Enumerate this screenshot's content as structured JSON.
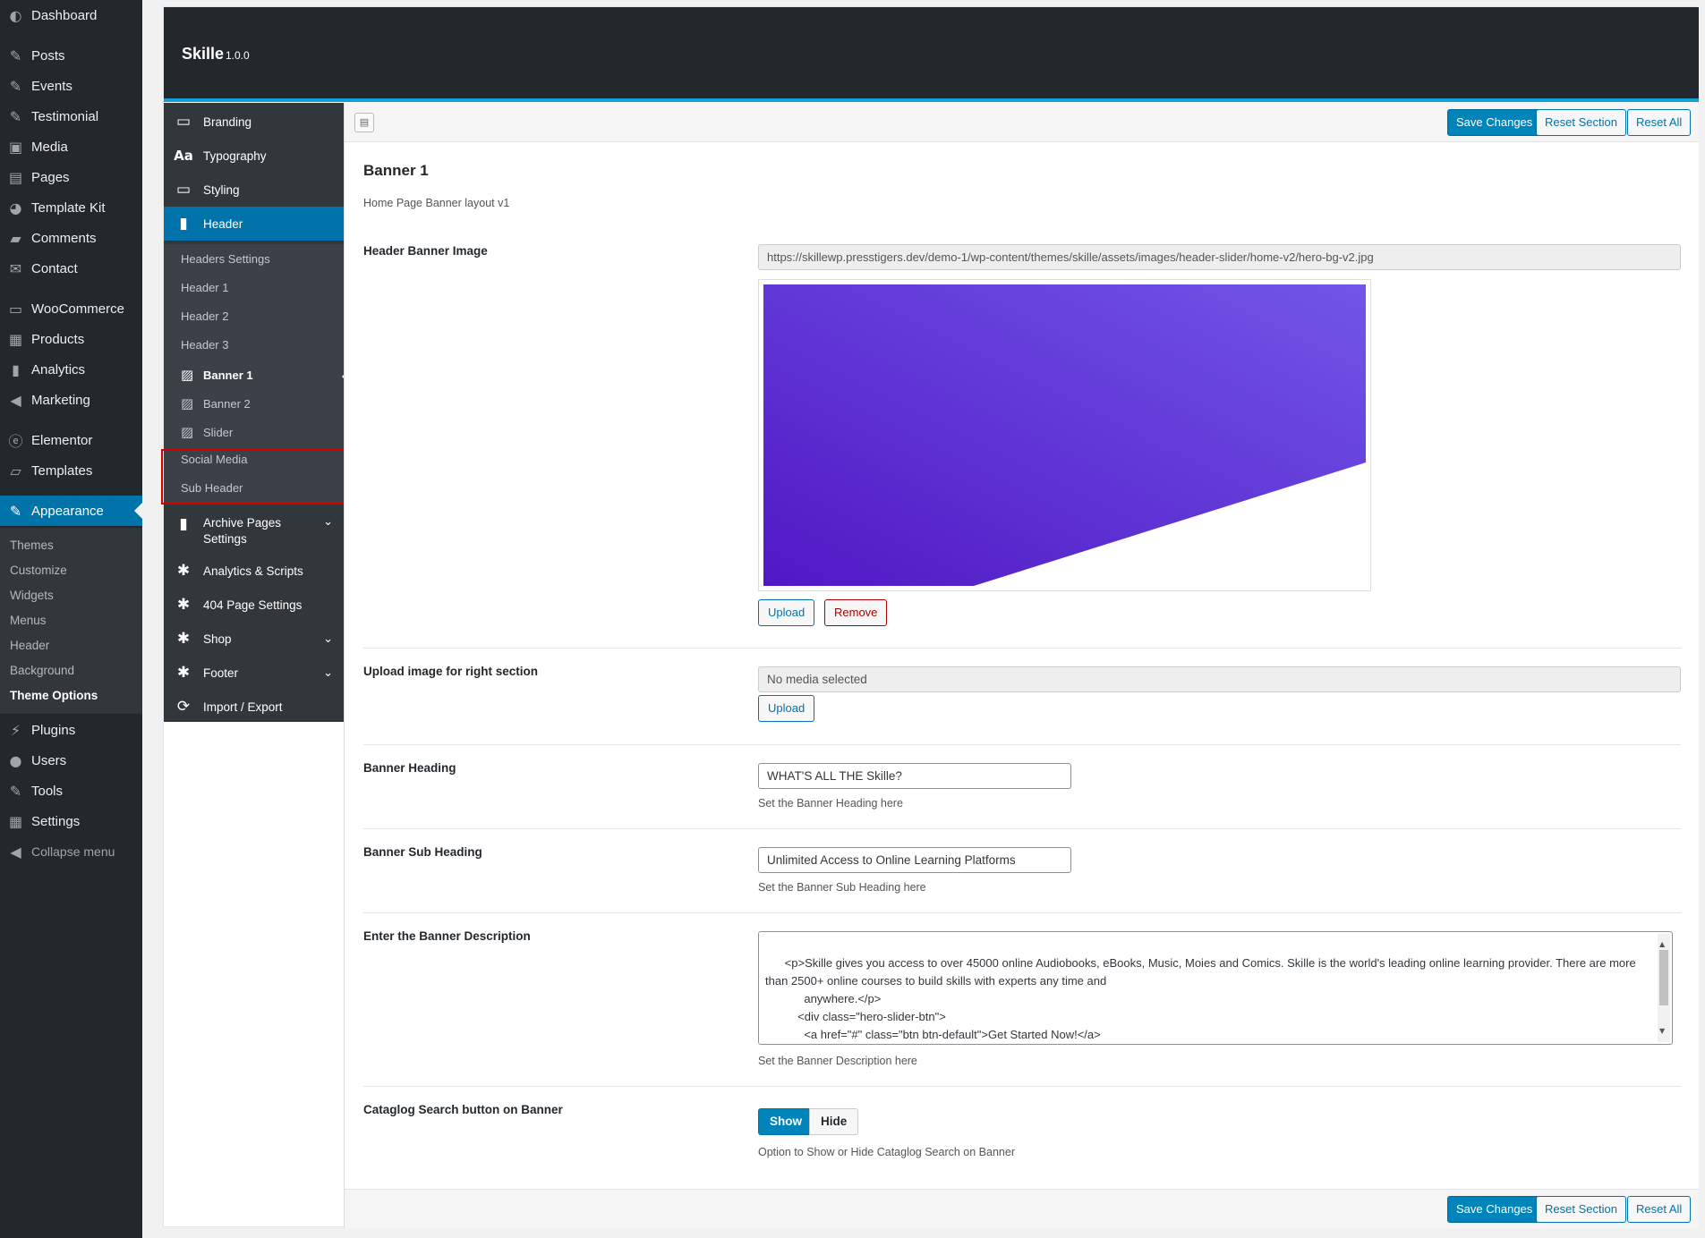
{
  "wp_menu": {
    "items": [
      {
        "label": "Dashboard",
        "icon": "dashboard-icon",
        "glyph": "◐"
      },
      {
        "label": "Posts",
        "icon": "pin-icon",
        "glyph": "✎"
      },
      {
        "label": "Events",
        "icon": "pin-icon",
        "glyph": "✎"
      },
      {
        "label": "Testimonial",
        "icon": "pin-icon",
        "glyph": "✎"
      },
      {
        "label": "Media",
        "icon": "media-icon",
        "glyph": "▣"
      },
      {
        "label": "Pages",
        "icon": "pages-icon",
        "glyph": "▤"
      },
      {
        "label": "Template Kit",
        "icon": "template-kit-icon",
        "glyph": "◕"
      },
      {
        "label": "Comments",
        "icon": "comments-icon",
        "glyph": "▰"
      },
      {
        "label": "Contact",
        "icon": "mail-icon",
        "glyph": "✉"
      },
      {
        "label": "WooCommerce",
        "icon": "woocommerce-icon",
        "glyph": "▭"
      },
      {
        "label": "Products",
        "icon": "products-icon",
        "glyph": "▦"
      },
      {
        "label": "Analytics",
        "icon": "analytics-icon",
        "glyph": "▮"
      },
      {
        "label": "Marketing",
        "icon": "megaphone-icon",
        "glyph": "◀"
      },
      {
        "label": "Elementor",
        "icon": "elementor-icon",
        "glyph": "ⓔ"
      },
      {
        "label": "Templates",
        "icon": "folder-icon",
        "glyph": "▱"
      },
      {
        "label": "Appearance",
        "icon": "brush-icon",
        "glyph": "✎"
      },
      {
        "label": "Plugins",
        "icon": "plugin-icon",
        "glyph": "⚡"
      },
      {
        "label": "Users",
        "icon": "user-icon",
        "glyph": "●"
      },
      {
        "label": "Tools",
        "icon": "wrench-icon",
        "glyph": "✎"
      },
      {
        "label": "Settings",
        "icon": "settings-icon",
        "glyph": "▦"
      },
      {
        "label": "Collapse menu",
        "icon": "collapse-icon",
        "glyph": "◀"
      }
    ],
    "appearance_sub": [
      "Themes",
      "Customize",
      "Widgets",
      "Menus",
      "Header",
      "Background",
      "Theme Options"
    ]
  },
  "panel": {
    "title": "Skille",
    "version": "1.0.0"
  },
  "nav": {
    "top": [
      {
        "label": "Branding",
        "icon": "monitor-icon",
        "glyph": "▭"
      },
      {
        "label": "Typography",
        "icon": "typography-icon",
        "glyph": "Aa"
      },
      {
        "label": "Styling",
        "icon": "monitor-icon",
        "glyph": "▭"
      },
      {
        "label": "Header",
        "icon": "bookmark-icon",
        "glyph": "▮"
      }
    ],
    "header_sub": [
      "Headers Settings",
      "Header 1",
      "Header 2",
      "Header 3",
      "Banner 1",
      "Banner 2",
      "Slider",
      "Social Media",
      "Sub Header"
    ],
    "bottom": [
      {
        "label": "Archive Pages",
        "label2": "Settings",
        "icon": "bookmark-icon",
        "glyph": "▮"
      },
      {
        "label": "Analytics & Scripts",
        "icon": "gear-icon",
        "glyph": "✱"
      },
      {
        "label": "404 Page Settings",
        "icon": "gear-icon",
        "glyph": "✱"
      },
      {
        "label": "Shop",
        "icon": "gear-icon",
        "glyph": "✱"
      },
      {
        "label": "Footer",
        "icon": "gear-icon",
        "glyph": "✱"
      },
      {
        "label": "Import / Export",
        "icon": "refresh-icon",
        "glyph": "⟳"
      }
    ]
  },
  "toolbar": {
    "save": "Save Changes",
    "reset_section": "Reset Section",
    "reset_all": "Reset All"
  },
  "section": {
    "title": "Banner 1",
    "description": "Home Page Banner layout v1"
  },
  "fields": {
    "header_banner_image": {
      "label": "Header Banner Image",
      "url": "https://skillewp.presstigers.dev/demo-1/wp-content/themes/skille/assets/images/header-slider/home-v2/hero-bg-v2.jpg",
      "upload": "Upload",
      "remove": "Remove",
      "colors": {
        "top": "#7256e8",
        "bottom": "#5018c4"
      }
    },
    "right_image": {
      "label": "Upload image for right section",
      "value": "No media selected",
      "upload": "Upload"
    },
    "banner_heading": {
      "label": "Banner Heading",
      "value": "WHAT'S ALL THE Skille?",
      "desc": "Set the Banner Heading here"
    },
    "banner_sub_heading": {
      "label": "Banner Sub Heading",
      "value": "Unlimited Access to Online Learning Platforms",
      "desc": "Set the Banner Sub Heading here"
    },
    "banner_description": {
      "label": "Enter the Banner Description",
      "value": "<p>Skille gives you access to over 45000 online Audiobooks, eBooks, Music, Moies and Comics. Skille is the world's leading online learning provider. There are more than 2500+ online courses to build skills with experts any time and\n            anywhere.</p>\n          <div class=\"hero-slider-btn\">\n            <a href=\"#\" class=\"btn btn-default\">Get Started Now!</a>\n            <a href=\"#\" class=\"btn btn-light\">Join Now</a>",
      "desc": "Set the Banner Description here"
    },
    "catalog_search": {
      "label": "Cataglog Search button on Banner",
      "show": "Show",
      "hide": "Hide",
      "selected": "Show",
      "desc": "Option to Show or Hide Cataglog Search on Banner"
    }
  },
  "colors": {
    "accent": "#0073aa",
    "primary_button": "#0085ba",
    "header_bg": "#23282d",
    "highlight_border": "#d20000"
  }
}
